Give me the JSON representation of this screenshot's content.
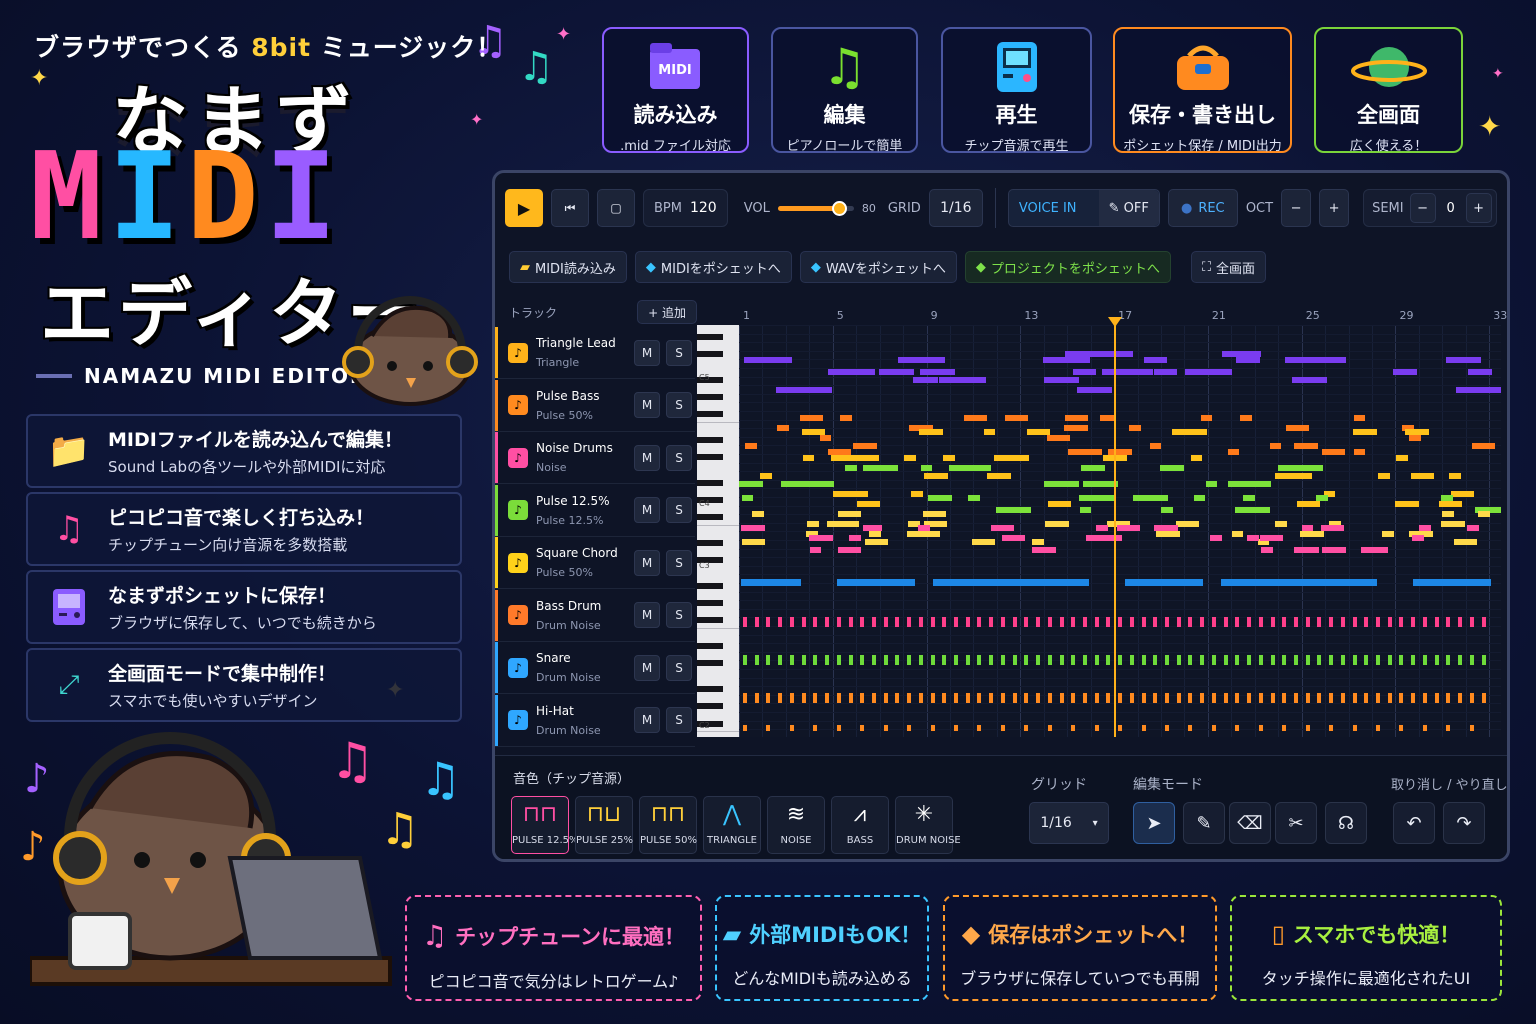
{
  "tagline": {
    "pre": "ブラウザでつくる ",
    "hl": "8bit",
    "post": " ミュージック！"
  },
  "logo": {
    "line1": "なまず",
    "midi": [
      "M",
      "I",
      "D",
      "I"
    ],
    "line2": "エディター",
    "en": "NAMAZU MIDI EDITOR"
  },
  "colors": {
    "midi": [
      "#ff4fa3",
      "#26b8ff",
      "#ff8a1f",
      "#9a5cff"
    ]
  },
  "features": [
    {
      "icon": "folder-icon",
      "title": "MIDIファイルを読み込んで編集！",
      "sub": "Sound Labの各ツールや外部MIDIに対応"
    },
    {
      "icon": "music-note-icon",
      "title": "ピコピコ音で楽しく打ち込み！",
      "sub": "チップチューン向け音源を多数搭載"
    },
    {
      "icon": "gameboy-icon",
      "title": "なまずポシェットに保存！",
      "sub": "ブラウザに保存して、いつでも続きから"
    },
    {
      "icon": "fullscreen-icon",
      "title": "全画面モードで集中制作！",
      "sub": "スマホでも使いやすいデザイン"
    }
  ],
  "top_cards": [
    {
      "title": "読み込み",
      "sub": ".mid ファイル対応",
      "icon_label": "MIDI"
    },
    {
      "title": "編集",
      "sub": "ピアノロールで簡単"
    },
    {
      "title": "再生",
      "sub": "チップ音源で再生"
    },
    {
      "title": "保存・書き出し",
      "sub": "ポシェット保存 / MIDI出力"
    },
    {
      "title": "全画面",
      "sub": "広く使える！"
    }
  ],
  "toolbar": {
    "bpm_label": "BPM",
    "bpm": "120",
    "vol_label": "VOL",
    "vol": "80",
    "vol_fraction": 0.8,
    "grid_label": "GRID",
    "grid": "1/16",
    "voice_in": "VOICE IN",
    "voice_state": "OFF",
    "rec": "REC",
    "oct_label": "OCT",
    "oct_minus": "−",
    "oct_plus": "+",
    "semi_label": "SEMI",
    "semi": "0",
    "semi_minus": "−",
    "semi_plus": "+"
  },
  "actions": [
    "MIDI読み込み",
    "MIDIをポシェットへ",
    "WAVをポシェットへ",
    "プロジェクトをポシェットへ",
    "全画面"
  ],
  "track_header": {
    "label": "トラック",
    "add": "+ 追加"
  },
  "tracks": [
    {
      "name": "Triangle Lead",
      "sub": "Triangle",
      "color": "#ffb21a",
      "icon": "triangle-wave-icon"
    },
    {
      "name": "Pulse Bass",
      "sub": "Pulse 50%",
      "color": "#ff8a1f",
      "icon": "pulse-wave-icon"
    },
    {
      "name": "Noise Drums",
      "sub": "Noise",
      "color": "#ff4fa3",
      "icon": "noise-icon"
    },
    {
      "name": "Pulse 12.5%",
      "sub": "Pulse 12.5%",
      "color": "#7bdc3a",
      "icon": "pulse-wave-icon"
    },
    {
      "name": "Square Chord",
      "sub": "Pulse 50%",
      "color": "#ffd21a",
      "icon": "square-wave-icon"
    },
    {
      "name": "Bass Drum",
      "sub": "Drum Noise",
      "color": "#ff7a2a",
      "icon": "drum-icon"
    },
    {
      "name": "Snare",
      "sub": "Drum Noise",
      "color": "#2fa7ff",
      "icon": "snare-icon"
    },
    {
      "name": "Hi-Hat",
      "sub": "Drum Noise",
      "color": "#2fa7ff",
      "icon": "hihat-icon"
    }
  ],
  "mute": "M",
  "solo": "S",
  "ruler": [
    "1",
    "5",
    "9",
    "13",
    "17",
    "21",
    "25",
    "29",
    "33"
  ],
  "key_labels": [
    "C5",
    "C4",
    "C3",
    "C2"
  ],
  "playhead_bar": 17,
  "bottom": {
    "voice_label": "音色（チップ音源）",
    "voices": [
      "PULSE 12.5%",
      "PULSE 25%",
      "PULSE 50%",
      "TRIANGLE",
      "NOISE",
      "BASS",
      "DRUM NOISE"
    ],
    "grid_label": "グリッド",
    "grid_value": "1/16",
    "mode_label": "編集モード",
    "undo_label": "取り消し / やり直し"
  },
  "bottom_cards": [
    {
      "title": "チップチューンに最適！",
      "sub": "ピコピコ音で気分はレトロゲーム♪",
      "color": "#ff5fb0"
    },
    {
      "title": "外部MIDIもOK！",
      "sub": "どんなMIDIも読み込める",
      "color": "#39c4ff"
    },
    {
      "title": "保存はポシェットへ！",
      "sub": "ブラウザに保存していつでも再開",
      "color": "#ff9a2a"
    },
    {
      "title": "スマホでも快適！",
      "sub": "タッチ操作に最適化されたUI",
      "color": "#9ae63a"
    }
  ]
}
